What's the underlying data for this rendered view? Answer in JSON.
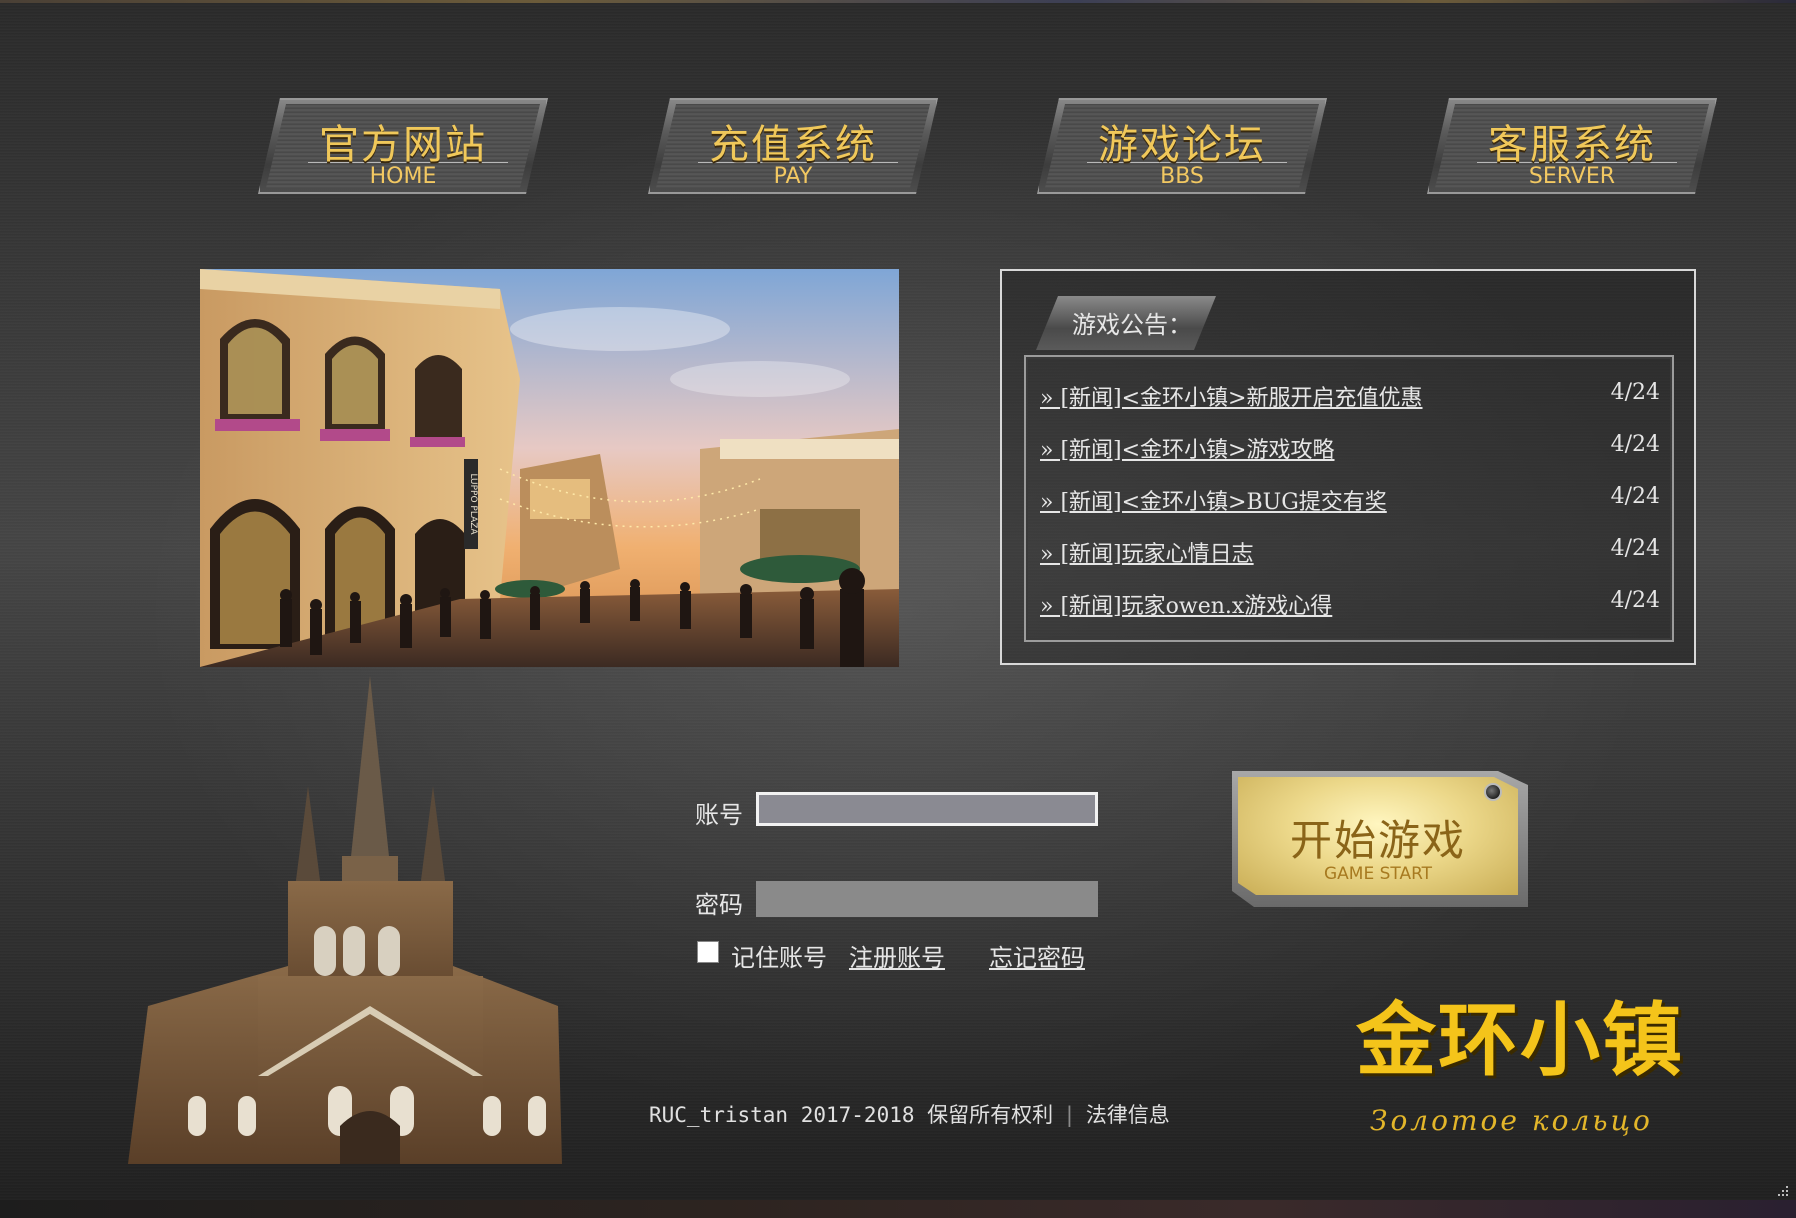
{
  "nav": [
    {
      "cn": "官方网站",
      "en": "HOME"
    },
    {
      "cn": "充值系统",
      "en": "PAY"
    },
    {
      "cn": "游戏论坛",
      "en": "BBS"
    },
    {
      "cn": "客服系统",
      "en": "SERVER"
    }
  ],
  "banner": {
    "sign_text": "LUPPO PLAZA"
  },
  "notice": {
    "title": "游戏公告：",
    "items": [
      {
        "text": "» [新闻]<金环小镇>新服开启充值优惠",
        "date": "4/24"
      },
      {
        "text": "» [新闻]<金环小镇>游戏攻略",
        "date": "4/24"
      },
      {
        "text": "» [新闻]<金环小镇>BUG提交有奖",
        "date": "4/24"
      },
      {
        "text": "» [新闻]玩家心情日志",
        "date": "4/24"
      },
      {
        "text": "» [新闻]玩家owen.x游戏心得",
        "date": "4/24"
      }
    ]
  },
  "login": {
    "account_label": "账号",
    "account_value": "",
    "password_label": "密码",
    "password_value": "",
    "remember_label": "记住账号",
    "remember_checked": false,
    "register_link": "注册账号",
    "forgot_link": "忘记密码"
  },
  "start_button": {
    "cn": "开始游戏",
    "en": "GAME START"
  },
  "brand": {
    "title": "金环小镇",
    "subtitle": "Золотое кольцо",
    "color": "#f4c41a"
  },
  "footer": {
    "copyright": "RUC_tristan 2017-2018 保留所有权利",
    "separator": "|",
    "legal_link": "法律信息"
  }
}
